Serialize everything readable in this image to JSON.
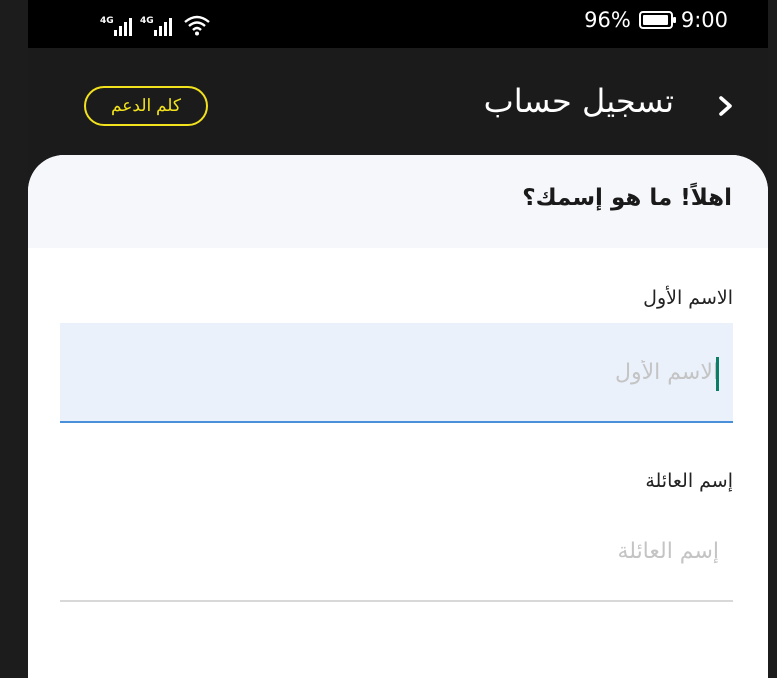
{
  "status_bar": {
    "network_1": "4G",
    "network_2": "4G",
    "battery": "96%",
    "battery_level": 0.96,
    "time": "9:00",
    "icons": [
      "signal-icon",
      "signal-icon",
      "wifi-icon",
      "battery-icon"
    ]
  },
  "header": {
    "title": "تسجيل حساب",
    "support_label": "كلم الدعم",
    "back_icon": "chevron-right-icon"
  },
  "card": {
    "title": "اهلاً! ما هو إسمك؟"
  },
  "form": {
    "first_name": {
      "label": "الاسم الأول",
      "placeholder": "الاسم الأول",
      "value": ""
    },
    "last_name": {
      "label": "إسم العائلة",
      "placeholder": "إسم العائلة",
      "value": ""
    }
  },
  "colors": {
    "accent_yellow": "#f2e21d",
    "focus_blue": "#4a8fd9",
    "caret_green": "#0e7d66",
    "header_bg": "#1b1b1b"
  }
}
